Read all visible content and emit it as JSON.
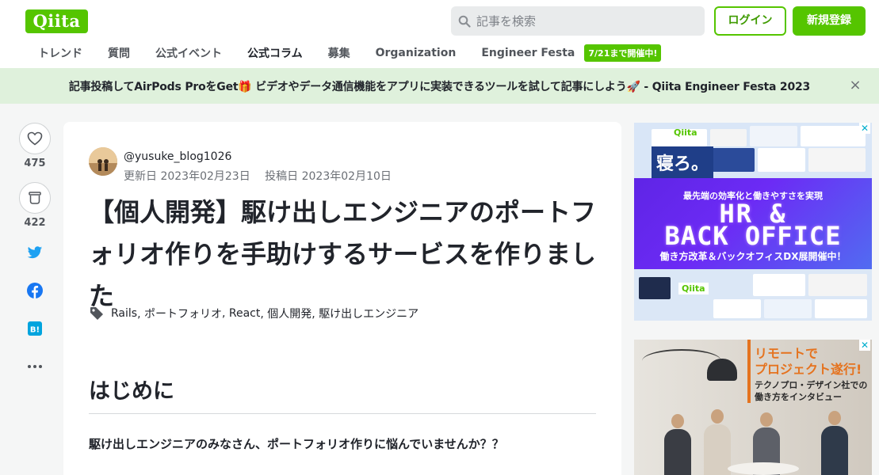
{
  "header": {
    "logo": "Qiita",
    "search_placeholder": "記事を検索",
    "login_label": "ログイン",
    "signup_label": "新規登録"
  },
  "nav": {
    "items": [
      {
        "label": "トレンド"
      },
      {
        "label": "質問"
      },
      {
        "label": "公式イベント"
      },
      {
        "label": "公式コラム"
      },
      {
        "label": "募集"
      },
      {
        "label": "Organization"
      },
      {
        "label": "Engineer Festa"
      }
    ],
    "badge": "7/21まで開催中!"
  },
  "banner": {
    "text": "記事投稿してAirPods ProをGet🎁 ビデオやデータ通信機能をアプリに実装できるツールを試して記事にしよう🚀 - Qiita Engineer Festa 2023",
    "close": "×"
  },
  "actions": {
    "like_count": "475",
    "stock_count": "422"
  },
  "article": {
    "user": "@yusuke_blog1026",
    "updated": "更新日 2023年02月23日",
    "posted": "投稿日 2023年02月10日",
    "title": "【個人開発】駆け出しエンジニアのポートフォリオ作りを手助けするサービスを作りました",
    "tags": [
      "Rails",
      "ポートフォリオ",
      "React",
      "個人開発",
      "駆け出しエンジニア"
    ],
    "heading": "はじめに",
    "lead": "駆け出しエンジニアのみなさん、ポートフォリオ作りに悩んでいませんか？？"
  },
  "ad1": {
    "qiita": "Qiita",
    "sleep": "寝ろ。",
    "sub": "最先端の効率化と働きやすさを実現",
    "big1": "HR &",
    "big2": "BACK OFFICE",
    "sub2": "働き方改革＆バックオフィスDX展開催中！",
    "qiita2": "Qiita",
    "close": "✕"
  },
  "ad2": {
    "line1": "リモートで",
    "line2": "プロジェクト遂行!",
    "line3": "テクノプロ・デザイン社での",
    "line4": "働き方をインタビュー",
    "close": "✕"
  },
  "colors": {
    "brand": "#55c500",
    "banner_bg": "#dff1dc",
    "twitter": "#1da1f2",
    "facebook": "#1877f2",
    "hatena": "#00a4de"
  }
}
